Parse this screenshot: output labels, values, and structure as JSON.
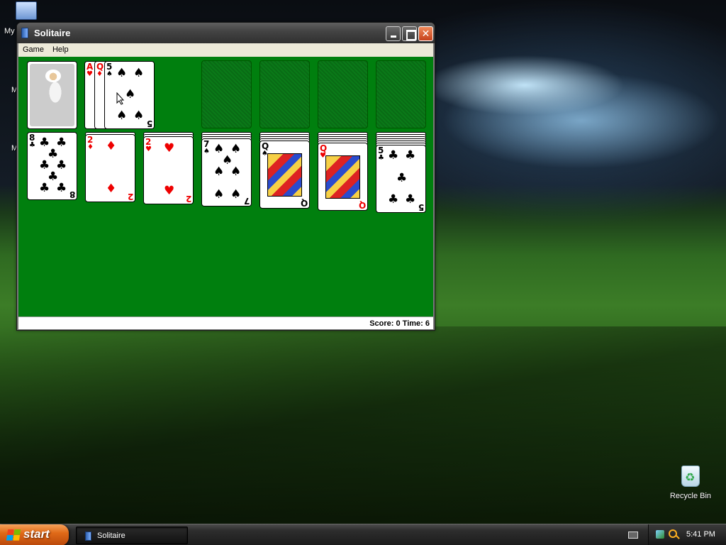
{
  "desktop": {
    "icons": [
      {
        "label": "My"
      },
      {
        "label": "Recycle Bin"
      }
    ],
    "cut_labels": [
      "M",
      "M"
    ]
  },
  "window": {
    "title": "Solitaire",
    "menu": [
      "Game",
      "Help"
    ],
    "status": "Score: 0 Time: 6"
  },
  "game": {
    "stock": {
      "back_design": "astronaut"
    },
    "waste": [
      {
        "rank": "A",
        "suit": "♥",
        "color": "red"
      },
      {
        "rank": "Q",
        "suit": "♦",
        "color": "red"
      },
      {
        "rank": "5",
        "suit": "♠",
        "color": "black"
      }
    ],
    "foundations": 4,
    "tableau": [
      {
        "hidden": 0,
        "rank": "8",
        "suit": "♣",
        "color": "black"
      },
      {
        "hidden": 1,
        "rank": "2",
        "suit": "♦",
        "color": "red"
      },
      {
        "hidden": 2,
        "rank": "2",
        "suit": "♥",
        "color": "red"
      },
      {
        "hidden": 3,
        "rank": "7",
        "suit": "♠",
        "color": "black"
      },
      {
        "hidden": 4,
        "rank": "Q",
        "suit": "♠",
        "color": "black"
      },
      {
        "hidden": 5,
        "rank": "Q",
        "suit": "♥",
        "color": "red"
      },
      {
        "hidden": 6,
        "rank": "5",
        "suit": "♣",
        "color": "black"
      }
    ]
  },
  "taskbar": {
    "start_label": "start",
    "task_label": "Solitaire",
    "clock": "5:41 PM"
  },
  "colors": {
    "felt": "#007f0e",
    "start": "#e06a18",
    "card_red": "#ee0000"
  }
}
